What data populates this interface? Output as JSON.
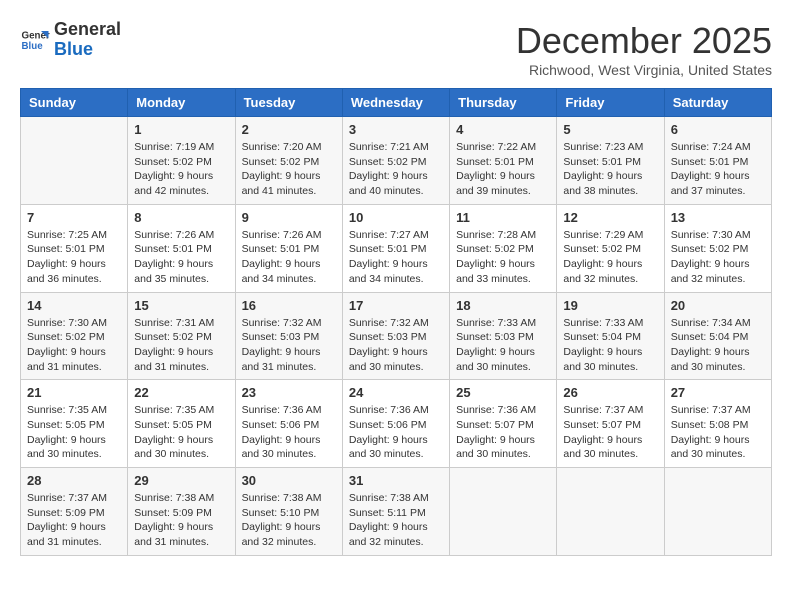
{
  "header": {
    "logo_line1": "General",
    "logo_line2": "Blue",
    "month": "December 2025",
    "location": "Richwood, West Virginia, United States"
  },
  "days_of_week": [
    "Sunday",
    "Monday",
    "Tuesday",
    "Wednesday",
    "Thursday",
    "Friday",
    "Saturday"
  ],
  "weeks": [
    [
      {
        "num": "",
        "info": ""
      },
      {
        "num": "1",
        "info": "Sunrise: 7:19 AM\nSunset: 5:02 PM\nDaylight: 9 hours\nand 42 minutes."
      },
      {
        "num": "2",
        "info": "Sunrise: 7:20 AM\nSunset: 5:02 PM\nDaylight: 9 hours\nand 41 minutes."
      },
      {
        "num": "3",
        "info": "Sunrise: 7:21 AM\nSunset: 5:02 PM\nDaylight: 9 hours\nand 40 minutes."
      },
      {
        "num": "4",
        "info": "Sunrise: 7:22 AM\nSunset: 5:01 PM\nDaylight: 9 hours\nand 39 minutes."
      },
      {
        "num": "5",
        "info": "Sunrise: 7:23 AM\nSunset: 5:01 PM\nDaylight: 9 hours\nand 38 minutes."
      },
      {
        "num": "6",
        "info": "Sunrise: 7:24 AM\nSunset: 5:01 PM\nDaylight: 9 hours\nand 37 minutes."
      }
    ],
    [
      {
        "num": "7",
        "info": "Sunrise: 7:25 AM\nSunset: 5:01 PM\nDaylight: 9 hours\nand 36 minutes."
      },
      {
        "num": "8",
        "info": "Sunrise: 7:26 AM\nSunset: 5:01 PM\nDaylight: 9 hours\nand 35 minutes."
      },
      {
        "num": "9",
        "info": "Sunrise: 7:26 AM\nSunset: 5:01 PM\nDaylight: 9 hours\nand 34 minutes."
      },
      {
        "num": "10",
        "info": "Sunrise: 7:27 AM\nSunset: 5:01 PM\nDaylight: 9 hours\nand 34 minutes."
      },
      {
        "num": "11",
        "info": "Sunrise: 7:28 AM\nSunset: 5:02 PM\nDaylight: 9 hours\nand 33 minutes."
      },
      {
        "num": "12",
        "info": "Sunrise: 7:29 AM\nSunset: 5:02 PM\nDaylight: 9 hours\nand 32 minutes."
      },
      {
        "num": "13",
        "info": "Sunrise: 7:30 AM\nSunset: 5:02 PM\nDaylight: 9 hours\nand 32 minutes."
      }
    ],
    [
      {
        "num": "14",
        "info": "Sunrise: 7:30 AM\nSunset: 5:02 PM\nDaylight: 9 hours\nand 31 minutes."
      },
      {
        "num": "15",
        "info": "Sunrise: 7:31 AM\nSunset: 5:02 PM\nDaylight: 9 hours\nand 31 minutes."
      },
      {
        "num": "16",
        "info": "Sunrise: 7:32 AM\nSunset: 5:03 PM\nDaylight: 9 hours\nand 31 minutes."
      },
      {
        "num": "17",
        "info": "Sunrise: 7:32 AM\nSunset: 5:03 PM\nDaylight: 9 hours\nand 30 minutes."
      },
      {
        "num": "18",
        "info": "Sunrise: 7:33 AM\nSunset: 5:03 PM\nDaylight: 9 hours\nand 30 minutes."
      },
      {
        "num": "19",
        "info": "Sunrise: 7:33 AM\nSunset: 5:04 PM\nDaylight: 9 hours\nand 30 minutes."
      },
      {
        "num": "20",
        "info": "Sunrise: 7:34 AM\nSunset: 5:04 PM\nDaylight: 9 hours\nand 30 minutes."
      }
    ],
    [
      {
        "num": "21",
        "info": "Sunrise: 7:35 AM\nSunset: 5:05 PM\nDaylight: 9 hours\nand 30 minutes."
      },
      {
        "num": "22",
        "info": "Sunrise: 7:35 AM\nSunset: 5:05 PM\nDaylight: 9 hours\nand 30 minutes."
      },
      {
        "num": "23",
        "info": "Sunrise: 7:36 AM\nSunset: 5:06 PM\nDaylight: 9 hours\nand 30 minutes."
      },
      {
        "num": "24",
        "info": "Sunrise: 7:36 AM\nSunset: 5:06 PM\nDaylight: 9 hours\nand 30 minutes."
      },
      {
        "num": "25",
        "info": "Sunrise: 7:36 AM\nSunset: 5:07 PM\nDaylight: 9 hours\nand 30 minutes."
      },
      {
        "num": "26",
        "info": "Sunrise: 7:37 AM\nSunset: 5:07 PM\nDaylight: 9 hours\nand 30 minutes."
      },
      {
        "num": "27",
        "info": "Sunrise: 7:37 AM\nSunset: 5:08 PM\nDaylight: 9 hours\nand 30 minutes."
      }
    ],
    [
      {
        "num": "28",
        "info": "Sunrise: 7:37 AM\nSunset: 5:09 PM\nDaylight: 9 hours\nand 31 minutes."
      },
      {
        "num": "29",
        "info": "Sunrise: 7:38 AM\nSunset: 5:09 PM\nDaylight: 9 hours\nand 31 minutes."
      },
      {
        "num": "30",
        "info": "Sunrise: 7:38 AM\nSunset: 5:10 PM\nDaylight: 9 hours\nand 32 minutes."
      },
      {
        "num": "31",
        "info": "Sunrise: 7:38 AM\nSunset: 5:11 PM\nDaylight: 9 hours\nand 32 minutes."
      },
      {
        "num": "",
        "info": ""
      },
      {
        "num": "",
        "info": ""
      },
      {
        "num": "",
        "info": ""
      }
    ]
  ]
}
